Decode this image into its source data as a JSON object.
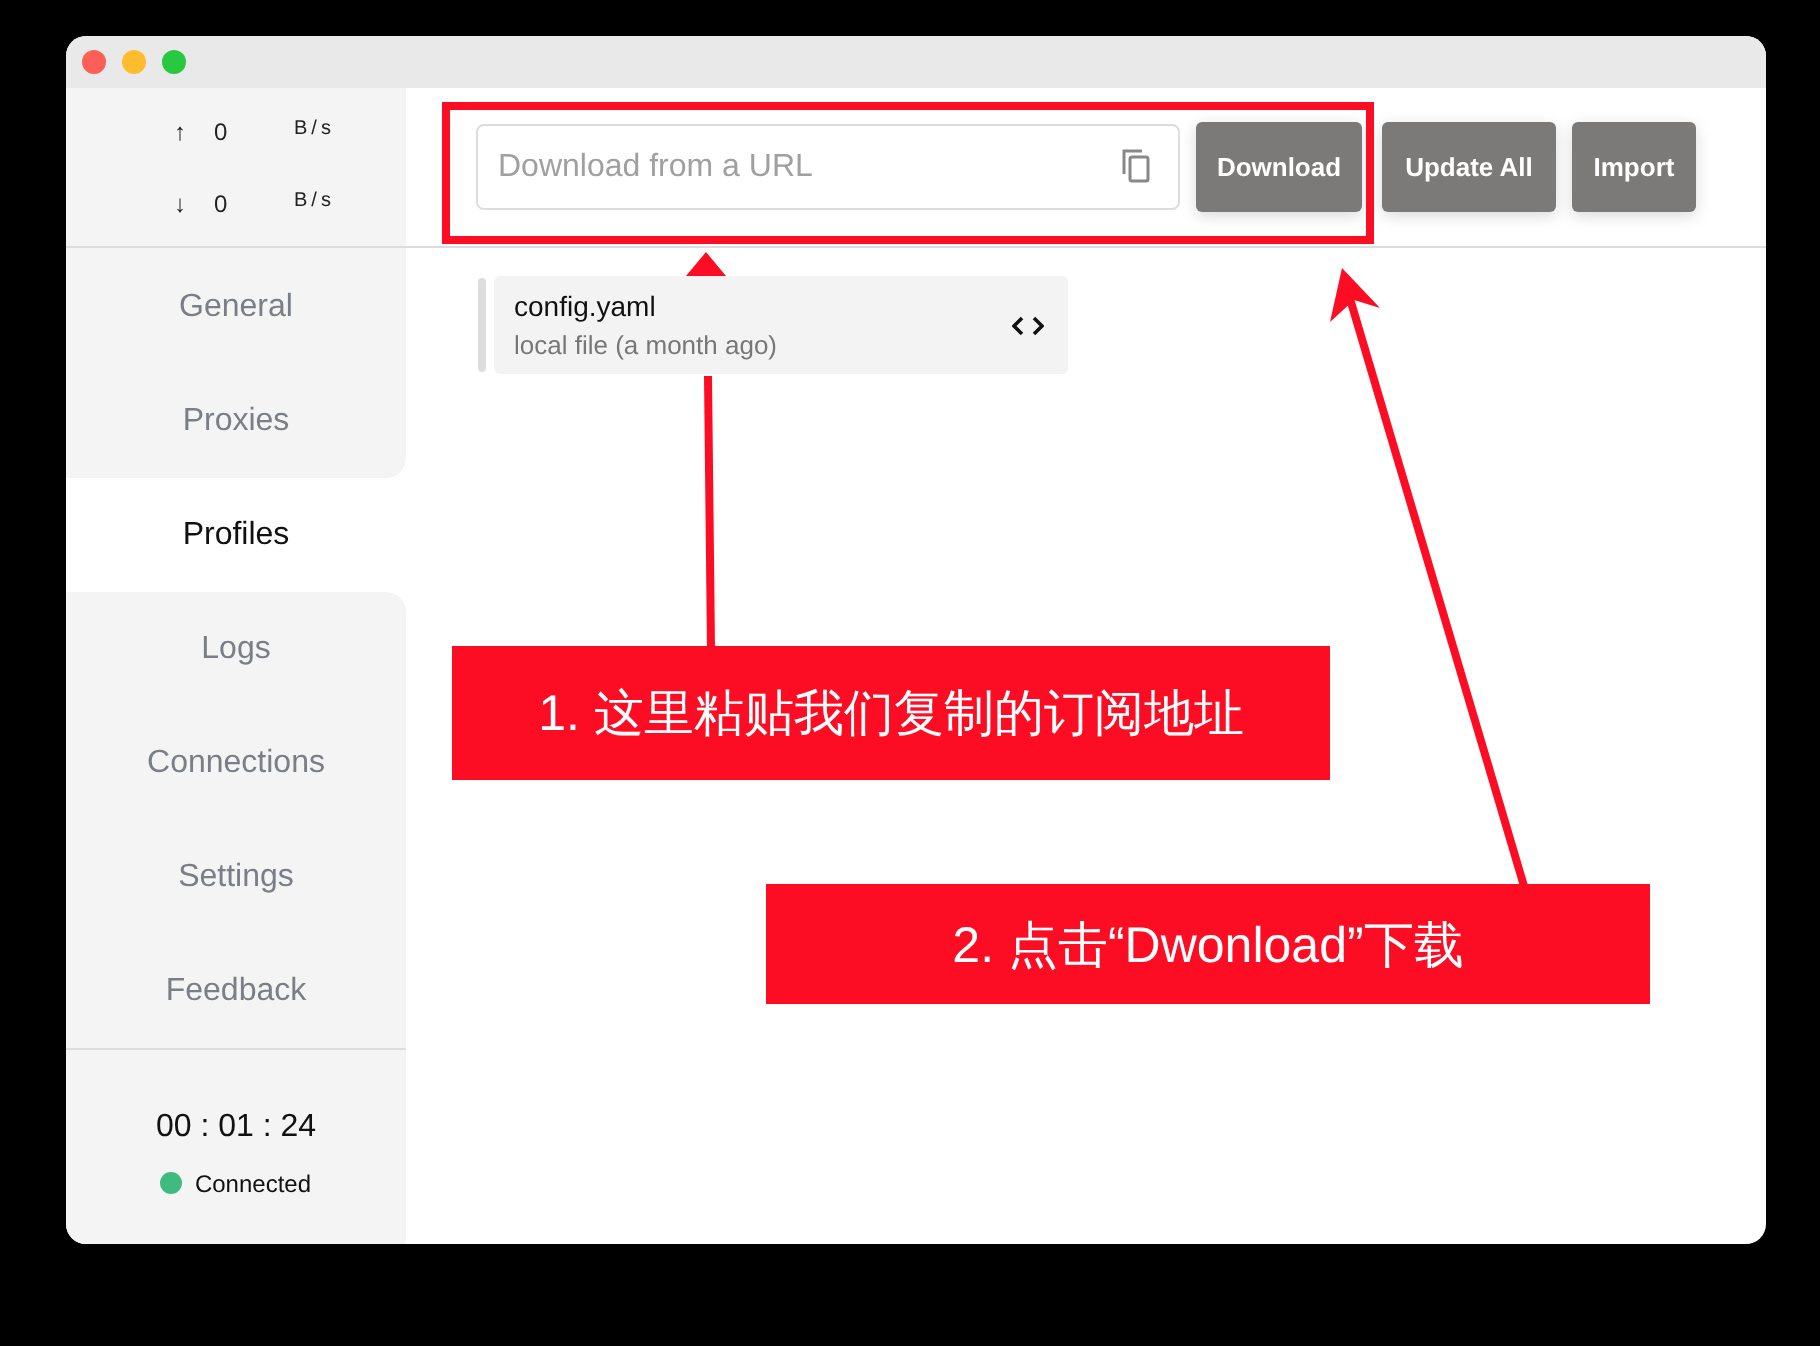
{
  "traffic": [
    {
      "arrow": "↑",
      "value": "0",
      "unit": "B/s"
    },
    {
      "arrow": "↓",
      "value": "0",
      "unit": "B/s"
    }
  ],
  "nav": [
    {
      "label": "General",
      "selected": false
    },
    {
      "label": "Proxies",
      "selected": false
    },
    {
      "label": "Profiles",
      "selected": true
    },
    {
      "label": "Logs",
      "selected": false
    },
    {
      "label": "Connections",
      "selected": false
    },
    {
      "label": "Settings",
      "selected": false
    },
    {
      "label": "Feedback",
      "selected": false
    }
  ],
  "uptime": "00 : 01 : 24",
  "status": {
    "label": "Connected",
    "color": "#3fbb80"
  },
  "url_field": {
    "placeholder": "Download from a URL"
  },
  "buttons": [
    "Download",
    "Update All",
    "Import"
  ],
  "profiles": [
    {
      "name": "config.yaml",
      "detail": "local file (a month ago)"
    }
  ],
  "annotations": [
    "1. 这里粘贴我们复制的订阅地址",
    "2. 点击“Dwonload”下载"
  ]
}
